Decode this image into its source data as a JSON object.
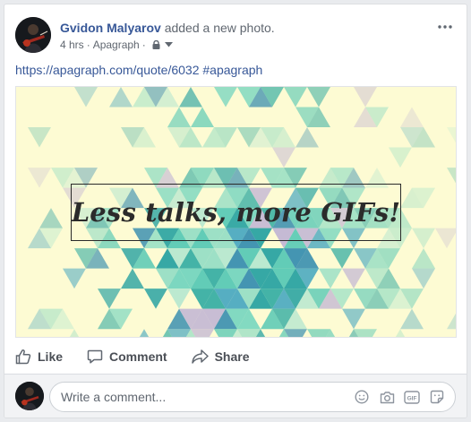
{
  "post": {
    "author_name": "Gvidon Malyarov",
    "action_text": "added a new photo.",
    "timestamp": "4 hrs",
    "separator": "·",
    "source": "Apagraph",
    "privacy_icon": "lock-icon",
    "text": "https://apagraph.com/quote/6032 #apagraph"
  },
  "image": {
    "quote": "Less talks, more GIFs!",
    "background_color": "#fdfbd3",
    "accent_colors": [
      "#1aa5a2",
      "#5fd4c3",
      "#9fe7cf",
      "#2b8fb5",
      "#c7b9d9"
    ]
  },
  "actions": {
    "like_label": "Like",
    "comment_label": "Comment",
    "share_label": "Share"
  },
  "comment": {
    "placeholder": "Write a comment...",
    "icons": [
      "emoji-icon",
      "camera-icon",
      "gif-icon",
      "sticker-icon"
    ]
  },
  "colors": {
    "link": "#385898",
    "secondary_text": "#606770",
    "action_text": "#4b4f56"
  }
}
